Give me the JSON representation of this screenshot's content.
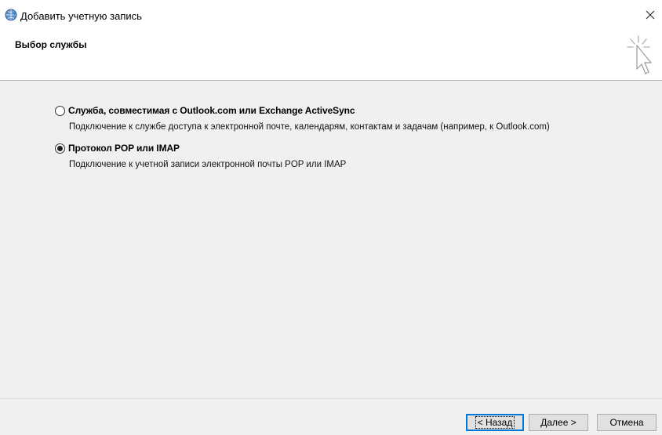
{
  "window": {
    "title": "Добавить учетную запись",
    "icon": "outlook-globe-icon"
  },
  "header": {
    "title": "Выбор службы",
    "icon": "wizard-cursor-icon"
  },
  "options": [
    {
      "label": "Служба, совместимая с Outlook.com или Exchange ActiveSync",
      "description": "Подключение к службе доступа к электронной почте, календарям, контактам и задачам (например, к Outlook.com)",
      "checked": false
    },
    {
      "label": "Протокол POP или IMAP",
      "description": "Подключение к учетной записи электронной почты POP или IMAP",
      "checked": true
    }
  ],
  "buttons": {
    "back": "< Назад",
    "next": "Далее >",
    "cancel": "Отмена"
  },
  "colors": {
    "background": "#f0f0f0",
    "header_bg": "#ffffff",
    "accent": "#0078d7"
  }
}
